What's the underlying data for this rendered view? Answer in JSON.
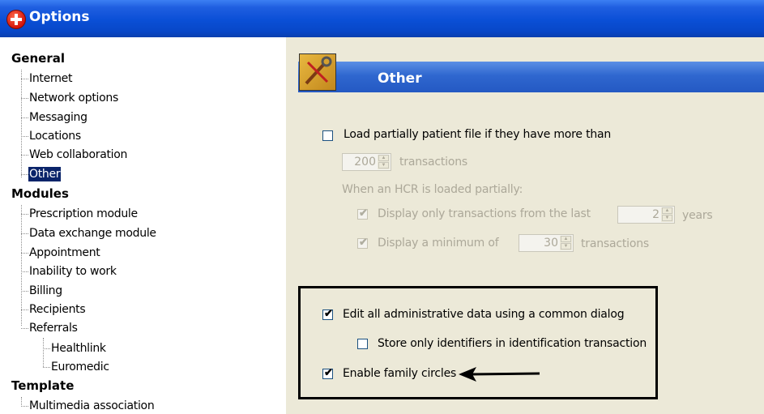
{
  "window": {
    "title": "Options",
    "app_icon": "red-cross-icon"
  },
  "tree": {
    "groups": [
      {
        "label": "General",
        "items": [
          "Internet",
          "Network options",
          "Messaging",
          "Locations",
          "Web collaboration",
          "Other"
        ]
      },
      {
        "label": "Modules",
        "items": [
          "Prescription module",
          "Data exchange module",
          "Appointment",
          "Inability to work",
          "Billing",
          "Recipients",
          "Referrals"
        ],
        "sub_items": [
          "Healthlink",
          "Euromedic"
        ]
      },
      {
        "label": "Template",
        "items": [
          "Multimedia association"
        ]
      }
    ],
    "selected": "Other"
  },
  "panel": {
    "title": "Other",
    "icon": "tools-icon",
    "load_partial": {
      "label": "Load partially patient file if they have more than",
      "checked": false
    },
    "transactions_spin": {
      "value": "200",
      "unit": "transactions"
    },
    "partial_heading": "When an HCR is loaded partially:",
    "display_last": {
      "label": "Display only transactions from the last",
      "checked": true,
      "value": "2",
      "unit": "years"
    },
    "display_min": {
      "label": "Display a minimum of",
      "checked": true,
      "value": "30",
      "unit": "transactions"
    },
    "edit_admin": {
      "label": "Edit all administrative data using a common dialog",
      "checked": true
    },
    "store_ids": {
      "label": "Store only identifiers in identification transaction",
      "checked": false
    },
    "family_circles": {
      "label": "Enable family circles",
      "checked": true
    }
  },
  "check_mark": "✔"
}
